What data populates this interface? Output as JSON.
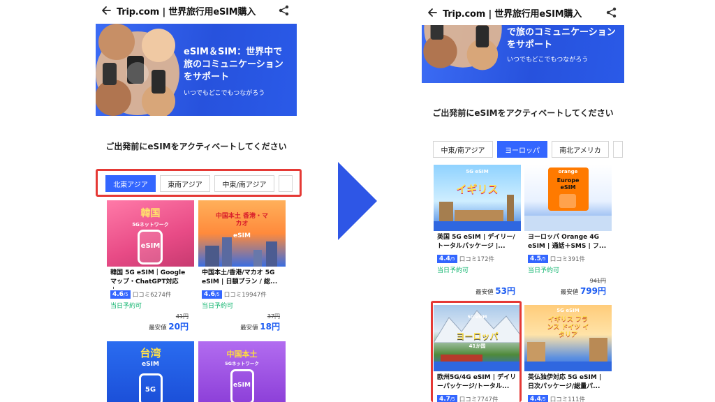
{
  "left": {
    "header": {
      "title": "Trip.com | 世界旅行用eSIM購入"
    },
    "banner": {
      "headline": "eSIM＆SIM：世界中で旅のコミュニケーションをサポート",
      "subtitle": "いつでもどこでもつながろう"
    },
    "section": {
      "heading": "ご出発前にeSIMをアクティベートしてください"
    },
    "tabs": [
      {
        "label": "北東アジア",
        "active": true
      },
      {
        "label": "東南アジア"
      },
      {
        "label": "中東/南アジア"
      }
    ],
    "cards": [
      {
        "image_title": "韓国",
        "image_tag": "5Gネットワーク",
        "image_sub": "eSIM",
        "name": "韓国 5G eSIM｜Googleマップ・ChatGPT対応｜...",
        "score": "4.6",
        "score_max": "/5",
        "reviews": "口コミ6274件",
        "same_day": "当日予約可",
        "original_price": "41円",
        "price_label": "最安値",
        "price": "20円"
      },
      {
        "image_title": "中国本土 香港・マカオ",
        "image_sub": "eSIM",
        "name": "中国本土/香港/マカオ 5G eSIM | 日額プラン / 総...",
        "score": "4.6",
        "score_max": "/5",
        "reviews": "口コミ19947件",
        "same_day": "当日予約可",
        "original_price": "37円",
        "price_label": "最安値",
        "price": "18円"
      },
      {
        "image_title": "台湾",
        "image_sub": "eSIM",
        "image_tag": "5G"
      },
      {
        "image_title": "中国本土",
        "image_tag": "5Gネットワーク",
        "image_sub": "eSIM"
      }
    ]
  },
  "right": {
    "header": {
      "title": "Trip.com | 世界旅行用eSIM購入"
    },
    "banner": {
      "headline": "で旅のコミュニケーションをサポート",
      "subtitle": "いつでもどこでもつながろう"
    },
    "section": {
      "heading": "ご出発前にeSIMをアクティベートしてください"
    },
    "tabs": [
      {
        "label": "中東/南アジア"
      },
      {
        "label": "ヨーロッパ",
        "active": true
      },
      {
        "label": "南北アメリカ"
      }
    ],
    "cards": [
      {
        "image_title": "イギリス",
        "image_tag": "5G eSIM",
        "name": "英国 5G eSIM | デイリー/トータルパッケージ |...",
        "score": "4.4",
        "score_max": "/5",
        "reviews": "口コミ172件",
        "same_day": "当日予約可",
        "original_price": "",
        "price_label": "最安値",
        "price": "53円"
      },
      {
        "image_title": "Europe eSIM",
        "image_tag": "orange",
        "name": "ヨーロッパ Orange 4G eSIM | 通話＋SMS | フ...",
        "score": "4.5",
        "score_max": "/5",
        "reviews": "口コミ391件",
        "same_day": "当日予約可",
        "original_price": "941円",
        "price_label": "最安値",
        "price": "799円"
      },
      {
        "image_title": "ヨーロッパ",
        "image_tag": "5G eSIM",
        "image_sub": "41か国",
        "name": "欧州5G/4G eSIM | デイリーパッケージ/トータル...",
        "score": "4.7",
        "score_max": "/5",
        "reviews": "口コミ7747件"
      },
      {
        "image_title": "イギリス フランス ドイツ イタリア",
        "image_tag": "5G eSIM",
        "name": "英仏独伊対応 5G eSIM | 日次パッケージ/総量パ...",
        "score": "4.4",
        "score_max": "/5",
        "reviews": "口コミ111件"
      }
    ]
  },
  "colors": {
    "accent": "#3366ff",
    "highlight": "#e53935",
    "arrow": "#2e56e6",
    "price": "#1c5cf2",
    "same_day": "#0ab36b"
  }
}
